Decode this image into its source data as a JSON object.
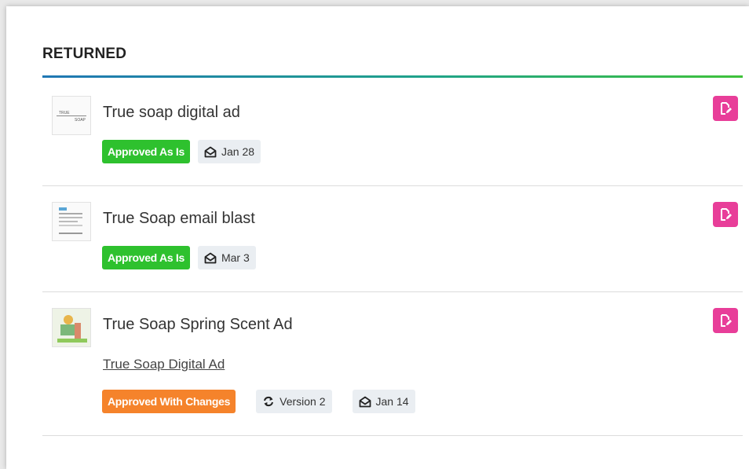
{
  "section": {
    "title": "RETURNED"
  },
  "colors": {
    "approved_as_is": "#2ec12e",
    "approved_with_changes": "#f5832b",
    "edit_button": "#e83e99"
  },
  "items": [
    {
      "title": "True soap digital ad",
      "status": "Approved As Is",
      "status_color": "#2ec12e",
      "date": "Jan 28",
      "thumb_text_top": "TRUE",
      "thumb_text_bottom": "SOAP"
    },
    {
      "title": "True Soap email blast",
      "status": "Approved As Is",
      "status_color": "#2ec12e",
      "date": "Mar 3"
    },
    {
      "title": "True Soap Spring Scent Ad",
      "link": "True Soap Digital Ad",
      "status": "Approved With Changes",
      "status_color": "#f5832b",
      "version": "Version 2",
      "date": "Jan 14"
    }
  ]
}
